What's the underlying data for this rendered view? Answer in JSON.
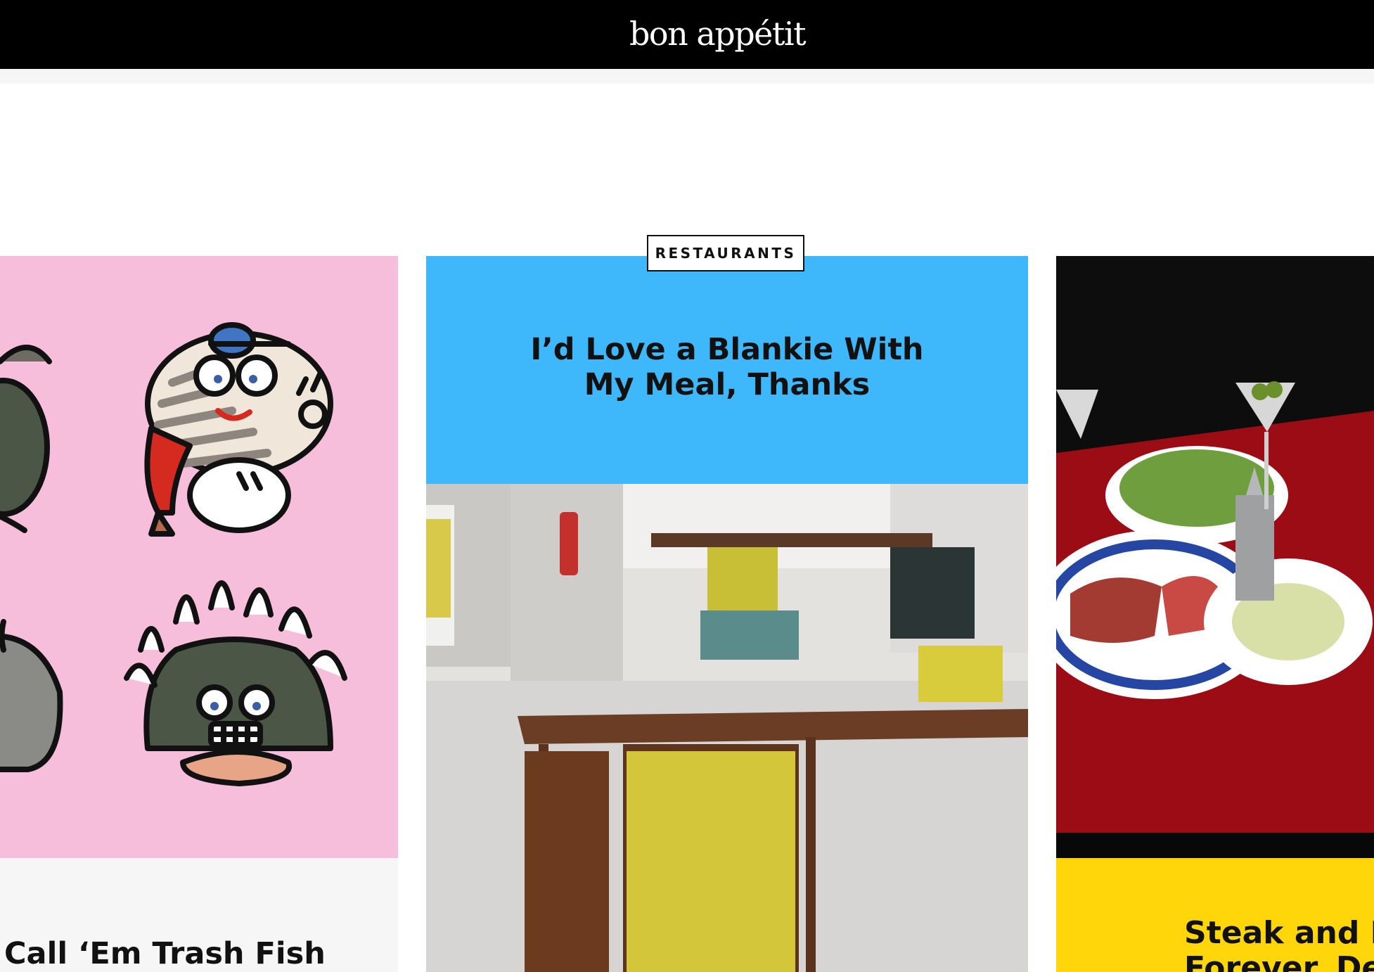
{
  "header": {
    "logo": "bon appétit"
  },
  "cards": {
    "left": {
      "title": "Call ‘Em Trash Fish"
    },
    "center": {
      "tag": "RESTAURANTS",
      "title_line1": "I’d Love a Blankie With",
      "title_line2": "My Meal, Thanks"
    },
    "right": {
      "title_line1": "Steak and M",
      "title_line2": "Forever, Dea"
    }
  },
  "colors": {
    "pink": "#f6bedb",
    "blue": "#3fb8fb",
    "yellow": "#ffd60a",
    "black": "#000000"
  }
}
